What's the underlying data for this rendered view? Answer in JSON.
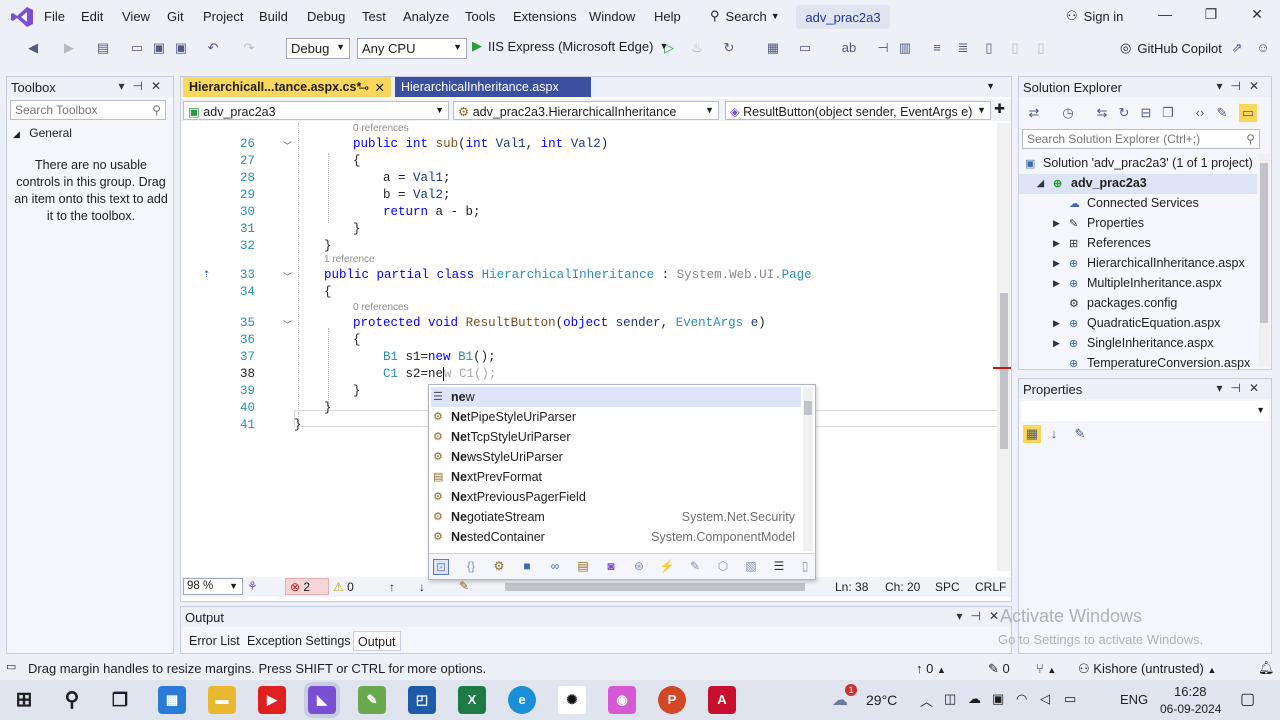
{
  "menubar": {
    "items": [
      "File",
      "Edit",
      "View",
      "Git",
      "Project",
      "Build",
      "Debug",
      "Test",
      "Analyze",
      "Tools",
      "Extensions",
      "Window",
      "Help"
    ],
    "search_label": "Search",
    "solution_title": "adv_prac2a3",
    "signin_label": "Sign in"
  },
  "toolbar": {
    "config": "Debug",
    "platform": "Any CPU",
    "run_label": "IIS Express (Microsoft Edge)",
    "copilot_label": "GitHub Copilot"
  },
  "toolbox": {
    "title": "Toolbox",
    "search_placeholder": "Search Toolbox",
    "group": "General",
    "empty_message": "There are no usable controls in this group. Drag an item onto this text to add it to the toolbox."
  },
  "editor": {
    "tabs": [
      "HierarchicalI...tance.aspx.cs*",
      "HierarchicalInheritance.aspx"
    ],
    "nav": [
      "adv_prac2a3",
      "adv_prac2a3.HierarchicalInheritance",
      "ResultButton(object sender, EventArgs e)"
    ],
    "refs": {
      "r0": "0 references",
      "r1": "1 reference",
      "r2": "0 references"
    },
    "line_numbers": [
      "26",
      "27",
      "28",
      "29",
      "30",
      "31",
      "32",
      "33",
      "34",
      "35",
      "36",
      "37",
      "38",
      "39",
      "40",
      "41"
    ],
    "zoom": "98 %",
    "errors": "2",
    "warnings": "0",
    "ln": "Ln: 38",
    "ch": "Ch: 20",
    "spc": "SPC",
    "crlf": "CRLF"
  },
  "autocomplete": {
    "items": [
      {
        "match": "ne",
        "rest": "w",
        "ns": ""
      },
      {
        "match": "Ne",
        "rest": "tPipeStyleUriParser",
        "ns": ""
      },
      {
        "match": "Ne",
        "rest": "tTcpStyleUriParser",
        "ns": ""
      },
      {
        "match": "Ne",
        "rest": "wsStyleUriParser",
        "ns": ""
      },
      {
        "match": "Ne",
        "rest": "xtPrevFormat",
        "ns": ""
      },
      {
        "match": "Ne",
        "rest": "xtPreviousPagerField",
        "ns": ""
      },
      {
        "match": "Ne",
        "rest": "gotiateStream",
        "ns": "System.Net.Security"
      },
      {
        "match": "Ne",
        "rest": "stedContainer",
        "ns": "System.ComponentModel"
      }
    ]
  },
  "output": {
    "title": "Output",
    "tabs": [
      "Error List",
      "Exception Settings",
      "Output"
    ]
  },
  "solution_explorer": {
    "title": "Solution Explorer",
    "search_placeholder": "Search Solution Explorer (Ctrl+;)",
    "solution": "Solution 'adv_prac2a3' (1 of 1 project)",
    "project": "adv_prac2a3",
    "items": [
      "Connected Services",
      "Properties",
      "References",
      "HierarchicalInheritance.aspx",
      "MultipleInheritance.aspx",
      "packages.config",
      "QuadraticEquation.aspx",
      "SingleInheritance.aspx",
      "TemperatureConversion.aspx"
    ]
  },
  "properties": {
    "title": "Properties"
  },
  "statusbar": {
    "message": "Drag margin handles to resize margins. Press SHIFT or CTRL for more options.",
    "up_count": "0",
    "edit_count": "0",
    "user": "Kishore (untrusted)"
  },
  "watermark": {
    "line1": "Activate Windows",
    "line2": "Go to Settings to activate Windows."
  },
  "taskbar": {
    "temp": "29°C",
    "lang": "ENG",
    "time": "16:28",
    "date": "06-09-2024",
    "badge": "1"
  }
}
